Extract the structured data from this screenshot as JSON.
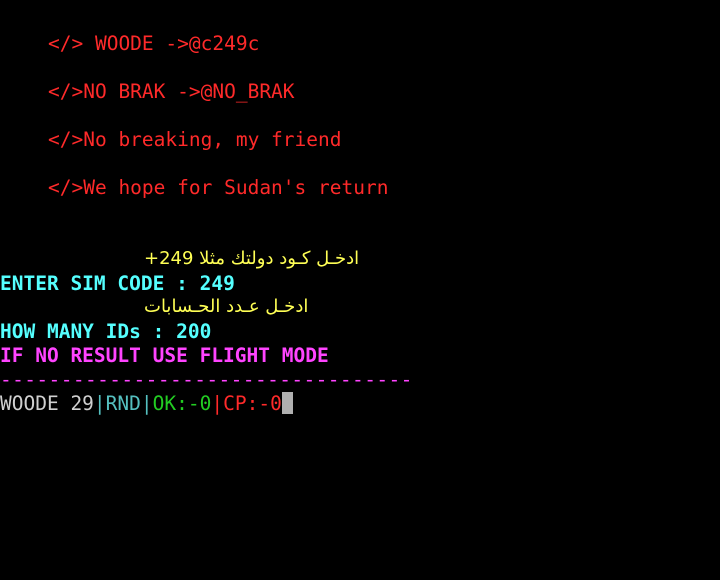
{
  "banner": {
    "lines": [
      "</> WOODE ->@c249c",
      "</>NO BRAK ->@NO_BRAK",
      "</>No breaking, my friend",
      "</>We hope for Sudan's return"
    ]
  },
  "prompts": {
    "sim_code_hint": "ادخـل كـود دولتك مثلا 249+",
    "sim_code_label": "ENTER SIM CODE : ",
    "sim_code_value": "249",
    "ids_hint": "ادخـل عـدد الحـسابات",
    "ids_label": "HOW MANY IDs : ",
    "ids_value": "200",
    "warning": "IF NO RESULT USE FLIGHT MODE",
    "divider": "----------------------------------"
  },
  "status": {
    "name": "WOODE 29",
    "sep1": "|",
    "mode": "RND",
    "sep2": "|",
    "ok": "OK:-0",
    "sep3": "|",
    "cp": "CP:-0"
  },
  "colors": {
    "background": "#000000",
    "banner": "#ff2a2a",
    "hint": "#ffff55",
    "prompt": "#55ffff",
    "warning": "#ff44ff",
    "ok": "#22cc22",
    "cp": "#ff2a2a"
  }
}
